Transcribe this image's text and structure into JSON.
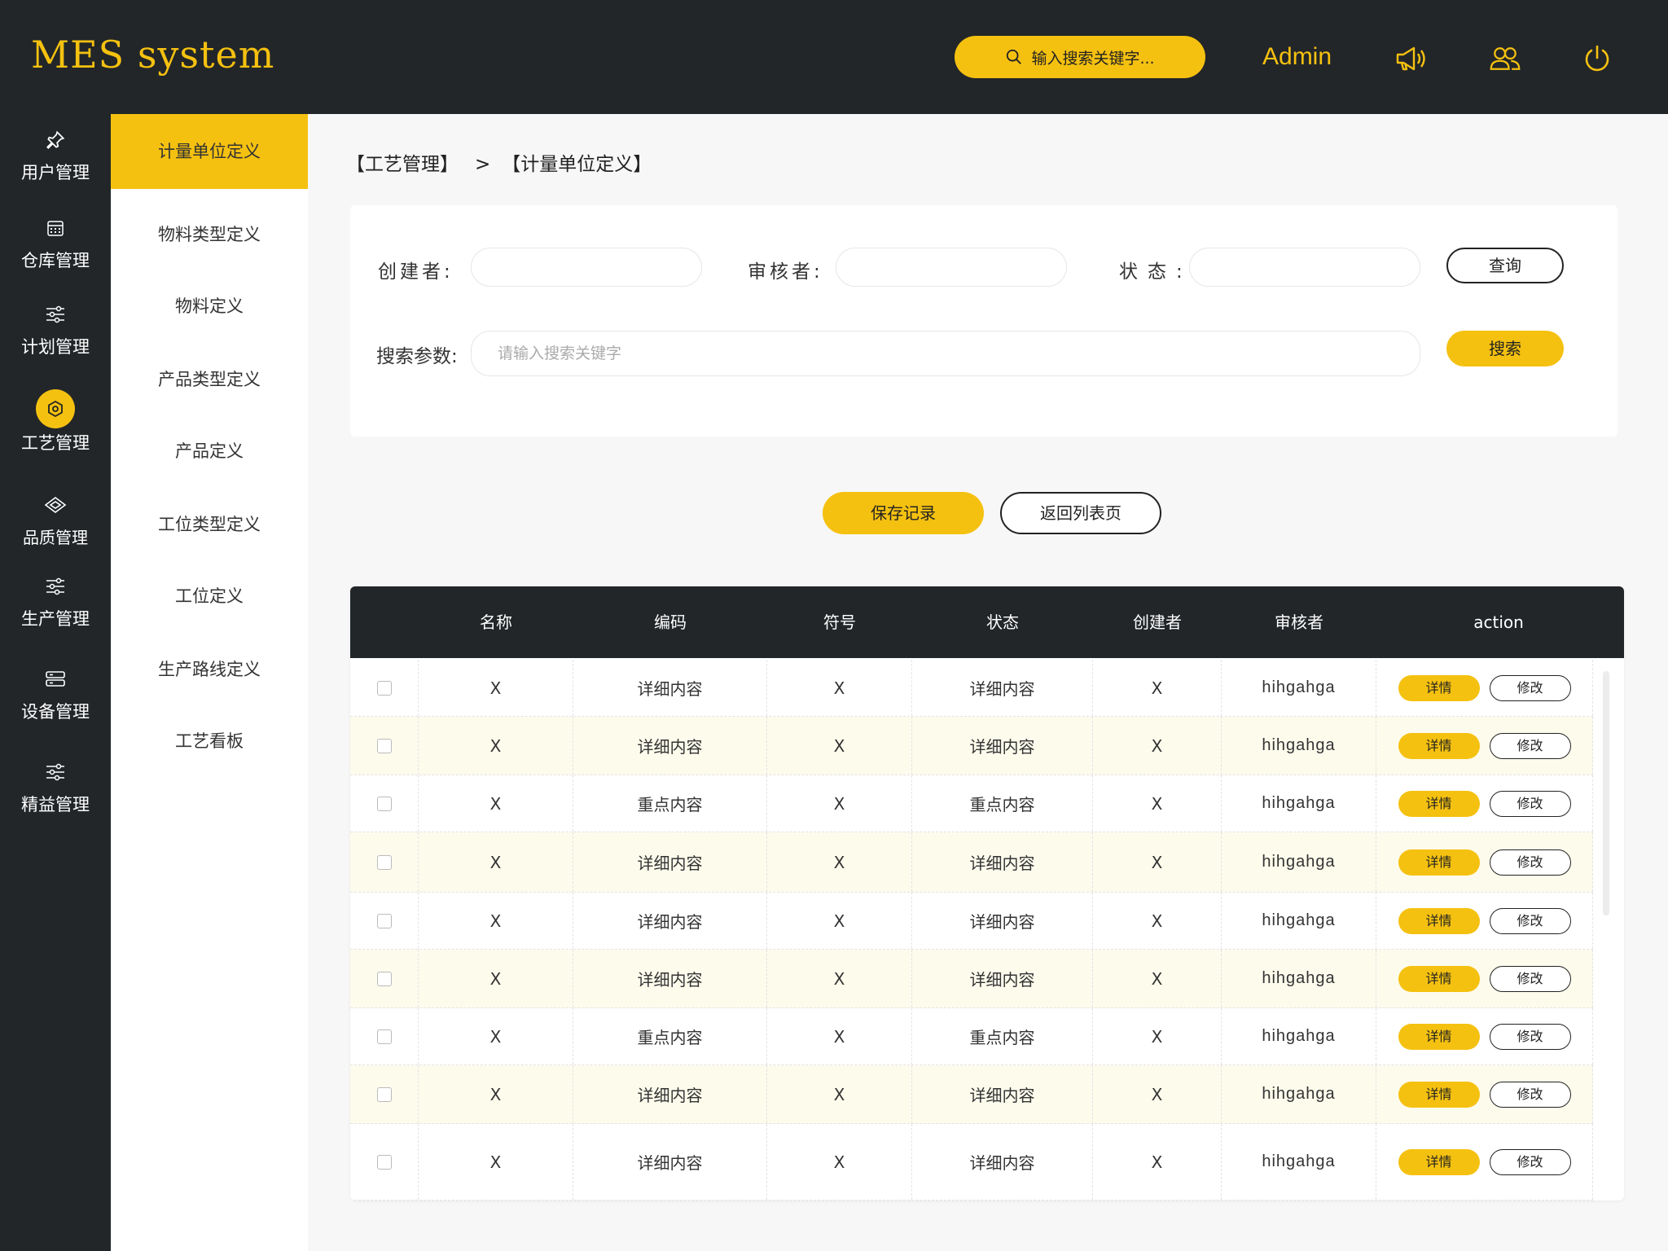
{
  "app": {
    "title": "MES system"
  },
  "header": {
    "search_placeholder": "输入搜索关键字...",
    "user": "Admin",
    "icons": [
      "megaphone-icon",
      "users-icon",
      "power-icon"
    ]
  },
  "sidebar": {
    "items": [
      {
        "label": "用户管理",
        "icon": "pin-icon"
      },
      {
        "label": "仓库管理",
        "icon": "calendar-icon"
      },
      {
        "label": "计划管理",
        "icon": "sliders-icon"
      },
      {
        "label": "工艺管理",
        "icon": "hexagon-icon",
        "active": true
      },
      {
        "label": "品质管理",
        "icon": "diamond-icon"
      },
      {
        "label": "生产管理",
        "icon": "sliders-icon"
      },
      {
        "label": "设备管理",
        "icon": "server-icon"
      },
      {
        "label": "精益管理",
        "icon": "sliders-icon"
      }
    ]
  },
  "submenu": {
    "items": [
      {
        "label": "计量单位定义",
        "active": true
      },
      {
        "label": "物料类型定义"
      },
      {
        "label": "物料定义"
      },
      {
        "label": "产品类型定义"
      },
      {
        "label": "产品定义"
      },
      {
        "label": "工位类型定义"
      },
      {
        "label": "工位定义"
      },
      {
        "label": "生产路线定义"
      },
      {
        "label": "工艺看板"
      }
    ]
  },
  "breadcrumb": {
    "parent": "【工艺管理】",
    "separator": ">",
    "current": "【计量单位定义】"
  },
  "filter": {
    "creator_label": "创建者:",
    "reviewer_label": "审核者:",
    "status_label": "状态:",
    "query_button": "查询",
    "search_label": "搜索参数:",
    "search_placeholder": "请输入搜索关键字",
    "search_button": "搜索"
  },
  "actions": {
    "save": "保存记录",
    "back": "返回列表页"
  },
  "table": {
    "columns": [
      "名称",
      "编码",
      "符号",
      "状态",
      "创建者",
      "审核者",
      "action"
    ],
    "detail_label": "详情",
    "edit_label": "修改",
    "rows": [
      {
        "name": "X",
        "code": "详细内容",
        "symbol": "X",
        "status": "详细内容",
        "creator": "X",
        "reviewer": "hihgahga"
      },
      {
        "name": "X",
        "code": "详细内容",
        "symbol": "X",
        "status": "详细内容",
        "creator": "X",
        "reviewer": "hihgahga"
      },
      {
        "name": "X",
        "code": "重点内容",
        "symbol": "X",
        "status": "重点内容",
        "creator": "X",
        "reviewer": "hihgahga"
      },
      {
        "name": "X",
        "code": "详细内容",
        "symbol": "X",
        "status": "详细内容",
        "creator": "X",
        "reviewer": "hihgahga"
      },
      {
        "name": "X",
        "code": "详细内容",
        "symbol": "X",
        "status": "详细内容",
        "creator": "X",
        "reviewer": "hihgahga"
      },
      {
        "name": "X",
        "code": "详细内容",
        "symbol": "X",
        "status": "详细内容",
        "creator": "X",
        "reviewer": "hihgahga"
      },
      {
        "name": "X",
        "code": "重点内容",
        "symbol": "X",
        "status": "重点内容",
        "creator": "X",
        "reviewer": "hihgahga"
      },
      {
        "name": "X",
        "code": "详细内容",
        "symbol": "X",
        "status": "详细内容",
        "creator": "X",
        "reviewer": "hihgahga"
      },
      {
        "name": "X",
        "code": "详细内容",
        "symbol": "X",
        "status": "详细内容",
        "creator": "X",
        "reviewer": "hihgahga"
      }
    ]
  },
  "colors": {
    "accent": "#f5c110",
    "dark": "#222629",
    "alt_row": "#fdfbec"
  }
}
